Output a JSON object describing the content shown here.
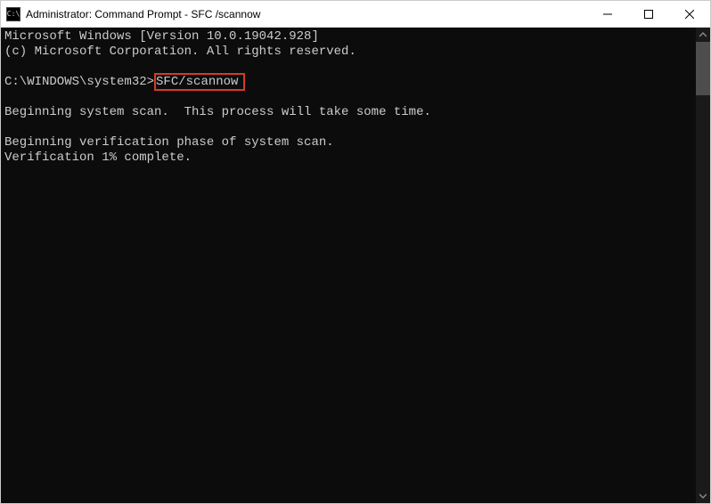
{
  "titlebar": {
    "icon_glyph": "C:\\",
    "title": "Administrator: Command Prompt - SFC /scannow"
  },
  "terminal": {
    "line1": "Microsoft Windows [Version 10.0.19042.928]",
    "line2": "(c) Microsoft Corporation. All rights reserved.",
    "blank1": "",
    "prompt_path": "C:\\WINDOWS\\system32>",
    "prompt_command": "SFC/scannow",
    "blank2": "",
    "line3": "Beginning system scan.  This process will take some time.",
    "blank3": "",
    "line4": "Beginning verification phase of system scan.",
    "line5": "Verification 1% complete."
  }
}
